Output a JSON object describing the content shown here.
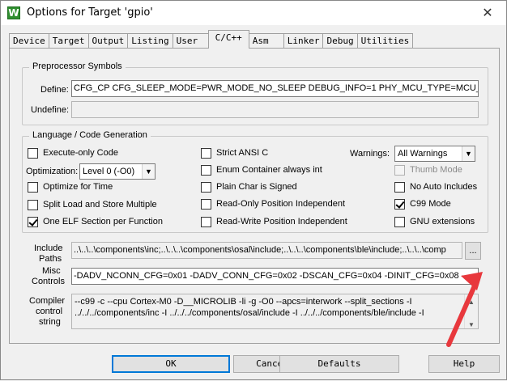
{
  "window": {
    "title": "Options for Target 'gpio'",
    "icon_name": "keil-uvision-icon",
    "close_glyph": "✕"
  },
  "tabs": [
    {
      "label": "Device"
    },
    {
      "label": "Target"
    },
    {
      "label": "Output"
    },
    {
      "label": "Listing"
    },
    {
      "label": "User"
    },
    {
      "label": "C/C++",
      "active": true
    },
    {
      "label": "Asm"
    },
    {
      "label": "Linker"
    },
    {
      "label": "Debug"
    },
    {
      "label": "Utilities"
    }
  ],
  "preprocessor": {
    "title": "Preprocessor Symbols",
    "define_label": "Define:",
    "define_value": "CFG_CP  CFG_SLEEP_MODE=PWR_MODE_NO_SLEEP DEBUG_INFO=1 PHY_MCU_TYPE=MCU_B",
    "undefine_label": "Undefine:",
    "undefine_value": ""
  },
  "language": {
    "title": "Language / Code Generation",
    "execute_only": {
      "label": "Execute-only Code",
      "checked": false
    },
    "optimization_label": "Optimization:",
    "optimization_value": "Level 0 (-O0)",
    "optimize_time": {
      "label": "Optimize for Time",
      "checked": false
    },
    "split_load": {
      "label": "Split Load and Store Multiple",
      "checked": false
    },
    "one_elf": {
      "label": "One ELF Section per Function",
      "checked": true
    },
    "strict_ansi": {
      "label": "Strict ANSI C",
      "checked": false
    },
    "enum_container": {
      "label": "Enum Container always int",
      "checked": false
    },
    "plain_char": {
      "label": "Plain Char is Signed",
      "checked": false
    },
    "ro_pi": {
      "label": "Read-Only Position Independent",
      "checked": false
    },
    "rw_pi": {
      "label": "Read-Write Position Independent",
      "checked": false
    },
    "warnings_label": "Warnings:",
    "warnings_value": "All Warnings",
    "thumb_mode": {
      "label": "Thumb Mode",
      "checked": false,
      "disabled": true
    },
    "no_auto_includes": {
      "label": "No Auto Includes",
      "checked": false
    },
    "c99_mode": {
      "label": "C99 Mode",
      "checked": true
    },
    "gnu_ext": {
      "label": "GNU extensions",
      "checked": false
    }
  },
  "include": {
    "label_line1": "Include",
    "label_line2": "Paths",
    "value": "..\\..\\..\\components\\inc;..\\..\\..\\components\\osal\\include;..\\..\\..\\components\\ble\\include;..\\..\\..\\comp",
    "browse_label": "..."
  },
  "misc": {
    "label_line1": "Misc",
    "label_line2": "Controls",
    "value": "-DADV_NCONN_CFG=0x01  -DADV_CONN_CFG=0x02  -DSCAN_CFG=0x04  -DINIT_CFG=0x08  -"
  },
  "compiler": {
    "label_line1": "Compiler",
    "label_line2": "control",
    "label_line3": "string",
    "line1": "--c99 -c --cpu Cortex-M0 -D__MICROLIB -li -g -O0 --apcs=interwork --split_sections -I",
    "line2": "../../../components/inc -I ../../../components/osal/include -I ../../../components/ble/include -I"
  },
  "buttons": {
    "ok": "OK",
    "cancel": "Cancel",
    "defaults": "Defaults",
    "help": "Help"
  },
  "annotation": {
    "color": "#e8383d"
  }
}
